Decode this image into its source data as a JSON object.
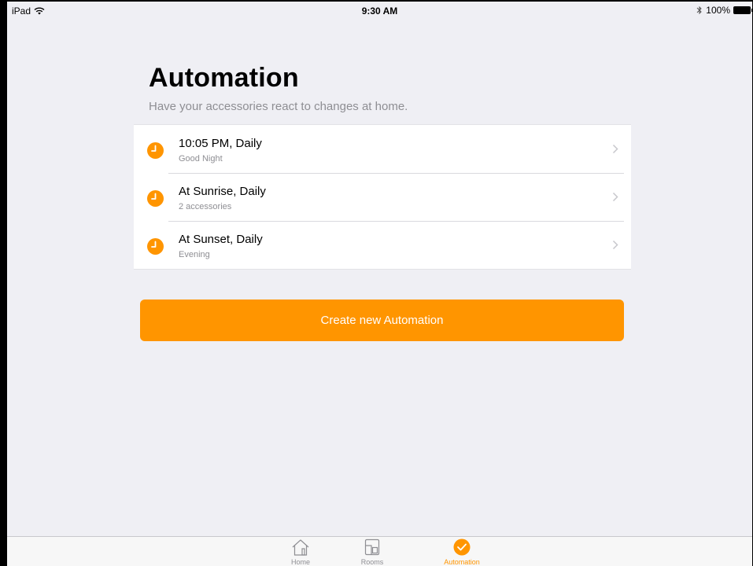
{
  "status_bar": {
    "device": "iPad",
    "time": "9:30 AM",
    "battery": "100%"
  },
  "header": {
    "title": "Automation",
    "subtitle": "Have your accessories react to changes at home."
  },
  "automations": [
    {
      "title": "10:05 PM, Daily",
      "subtitle": "Good Night",
      "icon": "clock-icon"
    },
    {
      "title": "At Sunrise, Daily",
      "subtitle": "2 accessories",
      "icon": "clock-icon"
    },
    {
      "title": "At Sunset, Daily",
      "subtitle": "Evening",
      "icon": "clock-icon"
    }
  ],
  "create_button": {
    "label": "Create new Automation"
  },
  "tab_bar": {
    "tabs": [
      {
        "label": "Home",
        "icon": "house-icon",
        "active": false
      },
      {
        "label": "Rooms",
        "icon": "rooms-icon",
        "active": false
      },
      {
        "label": "Automation",
        "icon": "automation-check-icon",
        "active": true
      }
    ]
  },
  "colors": {
    "accent": "#ff9500",
    "background": "#efeff4",
    "secondary_text": "#8e8e93"
  }
}
